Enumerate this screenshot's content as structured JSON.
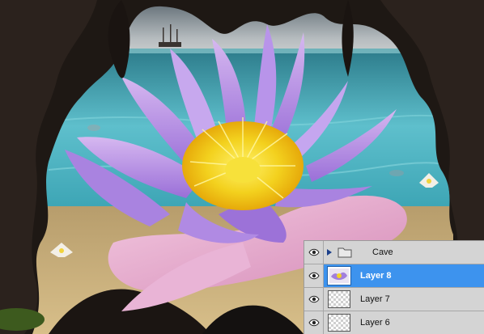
{
  "canvas": {
    "subject": "water lily in a rocky cave opening over a seabed"
  },
  "layers_panel": {
    "rows": [
      {
        "label": "Cave",
        "kind": "group",
        "visible": true,
        "selected": false,
        "icon": "folder-icon"
      },
      {
        "label": "Layer 8",
        "kind": "layer",
        "visible": true,
        "selected": true,
        "icon": "layer-thumbnail"
      },
      {
        "label": "Layer 7",
        "kind": "layer",
        "visible": true,
        "selected": false,
        "icon": "transparent-thumbnail"
      },
      {
        "label": "Layer 6",
        "kind": "layer",
        "visible": true,
        "selected": false,
        "icon": "transparent-thumbnail"
      }
    ]
  },
  "colors": {
    "selection": "#3d93ee",
    "panel_bg": "#d4d4d4",
    "row_border": "#a6a6a6"
  }
}
